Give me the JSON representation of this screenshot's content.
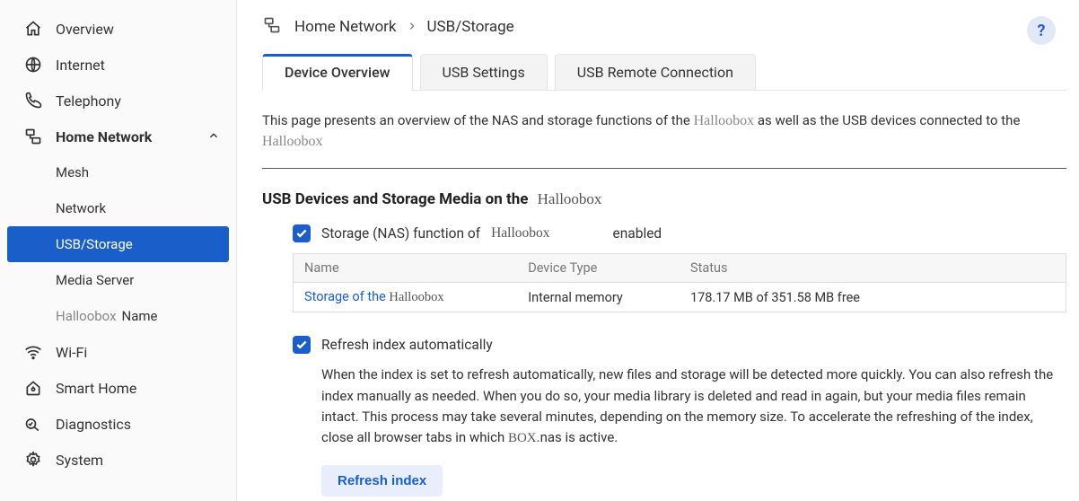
{
  "brand": "Halloobox",
  "sidebar": {
    "items": [
      {
        "label": "Overview"
      },
      {
        "label": "Internet"
      },
      {
        "label": "Telephony"
      },
      {
        "label": "Home Network",
        "expanded": true
      },
      {
        "label": "Wi-Fi"
      },
      {
        "label": "Smart Home"
      },
      {
        "label": "Diagnostics"
      },
      {
        "label": "System"
      }
    ],
    "homeNetwork": {
      "sub": [
        {
          "label": "Mesh"
        },
        {
          "label": "Network"
        },
        {
          "label": "USB/Storage",
          "selected": true
        },
        {
          "label": "Media Server"
        },
        {
          "label_prefix": "Halloobox",
          "label_suffix": "Name"
        }
      ]
    }
  },
  "breadcrumb": {
    "parent": "Home Network",
    "current": "USB/Storage"
  },
  "help": "?",
  "tabs": [
    {
      "label": "Device Overview",
      "active": true
    },
    {
      "label": "USB Settings"
    },
    {
      "label": "USB Remote Connection"
    }
  ],
  "intro": {
    "part1": "This page presents an overview of the NAS and storage functions of the",
    "part2": " as well as the USB devices connected to the "
  },
  "section": {
    "title_prefix": "USB Devices and Storage Media on the"
  },
  "nas_checkbox": {
    "checked": true,
    "label_prefix": "Storage (NAS) function of",
    "status": "enabled"
  },
  "table": {
    "headers": [
      "Name",
      "Device Type",
      "Status"
    ],
    "rows": [
      {
        "name_prefix": "Storage of the",
        "name_brand": "Halloobox",
        "device_type": "Internal memory",
        "status": "178.17 MB of 351.58 MB free"
      }
    ]
  },
  "refresh": {
    "checked": true,
    "label": "Refresh index automatically",
    "desc_part1": "When the index is set to refresh automatically, new files and storage will be detected more quickly. You can also refresh the index manually as needed. When you do so, your media library is deleted and read in again, but your media files remain intact. This process may take several minutes, depending on the memory size. To accelerate the refreshing of the index, close all browser tabs in which ",
    "desc_caps": "BOX",
    "desc_part2": ".nas is active.",
    "button": "Refresh index"
  }
}
